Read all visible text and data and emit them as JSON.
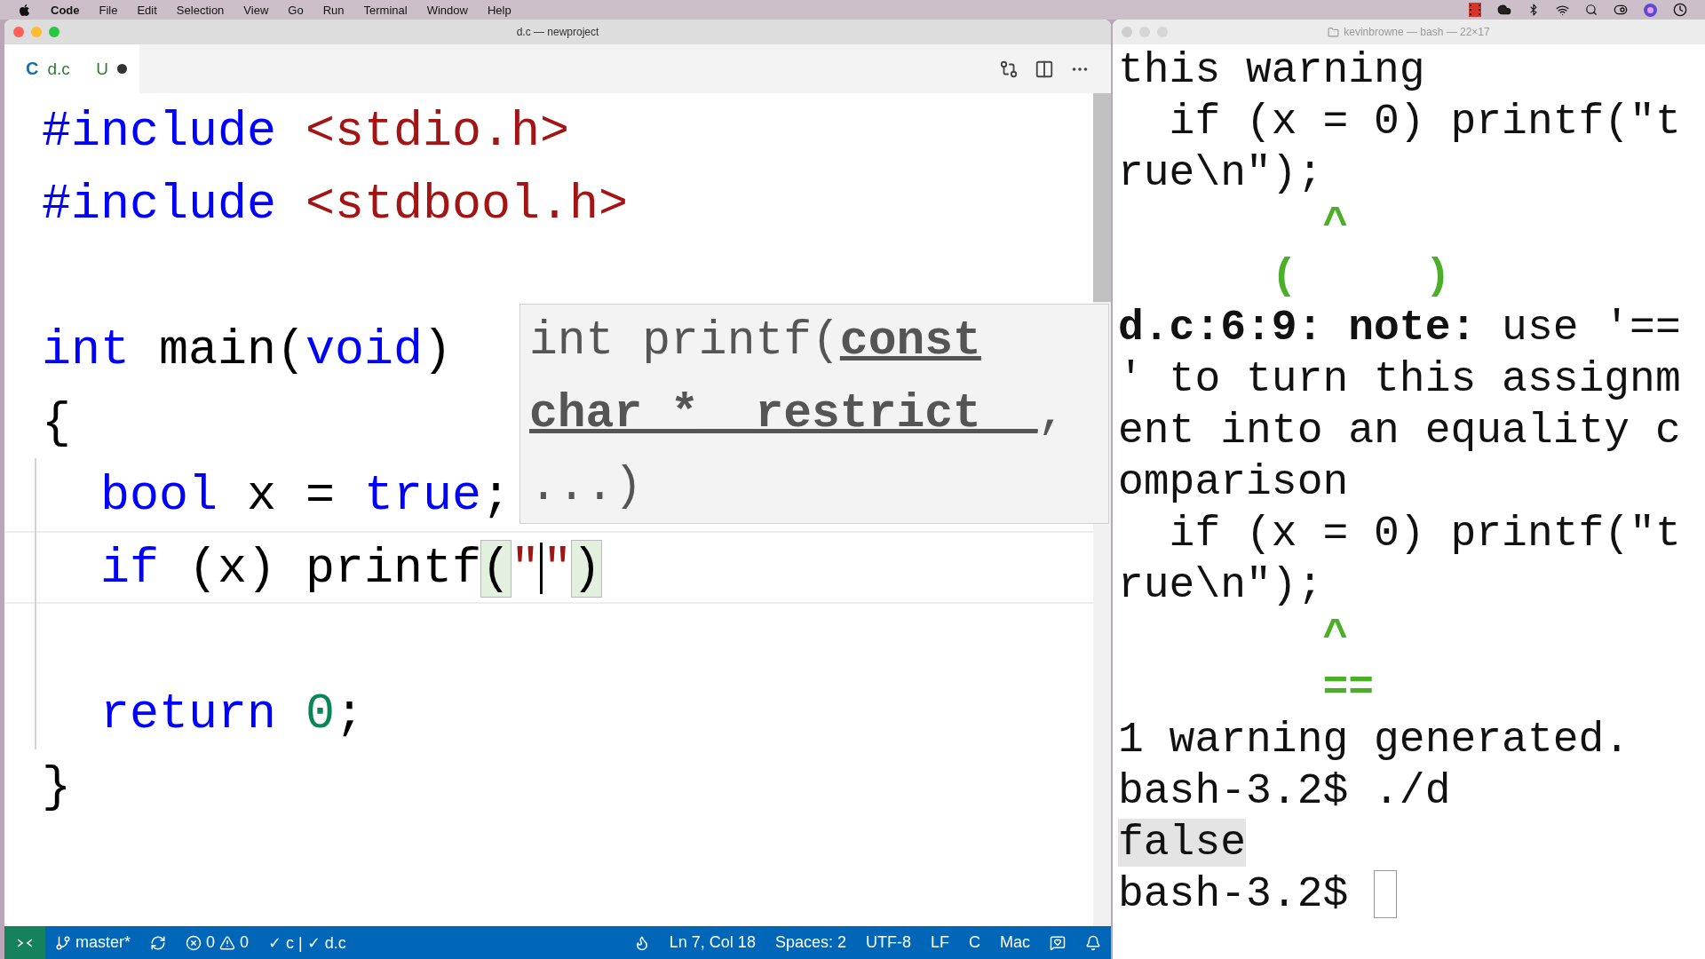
{
  "menu_bar": {
    "app": "Code",
    "items": [
      "File",
      "Edit",
      "Selection",
      "View",
      "Go",
      "Run",
      "Terminal",
      "Window",
      "Help"
    ]
  },
  "editor": {
    "window_title": "d.c — newproject",
    "tab": {
      "icon_letter": "C",
      "name": "d.c",
      "git_status": "U",
      "dirty": true,
      "selected": true
    },
    "code_lines": [
      {
        "current": false,
        "tokens": [
          {
            "kind": "keyword",
            "text": "#include"
          },
          {
            "kind": "string",
            "text": " <stdio.h>"
          }
        ]
      },
      {
        "current": false,
        "tokens": [
          {
            "kind": "keyword",
            "text": "#include"
          },
          {
            "kind": "string",
            "text": " <stdbool.h>"
          }
        ]
      },
      {
        "current": false
      },
      {
        "current": false,
        "tokens": [
          {
            "kind": "keyword",
            "text": "int"
          },
          {
            "kind": "plain",
            "text": " main("
          },
          {
            "kind": "keyword",
            "text": "void"
          },
          {
            "kind": "plain",
            "text": ")"
          }
        ]
      },
      {
        "current": false,
        "tokens": [
          {
            "kind": "plain",
            "text": "{"
          }
        ]
      },
      {
        "current": false,
        "tokens": [
          {
            "kind": "keyword",
            "text": "  bool"
          },
          {
            "kind": "plain",
            "text": " x = "
          },
          {
            "kind": "keyword",
            "text": "true"
          },
          {
            "kind": "plain",
            "text": ";"
          }
        ]
      },
      {
        "current": true,
        "tokens": [
          {
            "kind": "keyword",
            "text": "  if"
          },
          {
            "kind": "plain",
            "text": " (x) printf"
          },
          {
            "kind": "bracket",
            "text": "("
          },
          {
            "kind": "string",
            "text": "\""
          },
          {
            "kind": "caret"
          },
          {
            "kind": "string",
            "text": "\""
          },
          {
            "kind": "bracket",
            "text": ")"
          }
        ]
      },
      {
        "current": false
      },
      {
        "current": false,
        "tokens": [
          {
            "kind": "keyword",
            "text": "  return"
          },
          {
            "kind": "number",
            "text": " 0"
          },
          {
            "kind": "plain",
            "text": ";"
          }
        ]
      },
      {
        "current": false,
        "tokens": [
          {
            "kind": "plain",
            "text": "}"
          }
        ]
      }
    ],
    "hover": {
      "lines": [
        [
          {
            "kind": "plain",
            "text": "int printf("
          },
          {
            "kind": "param",
            "text": "const"
          }
        ],
        [
          {
            "kind": "param",
            "text": "char *__restrict__"
          },
          {
            "kind": "plain",
            "text": ","
          }
        ],
        [
          {
            "kind": "plain",
            "text": "...)"
          }
        ]
      ]
    },
    "status_bar": {
      "branch": "master*",
      "errors": "0",
      "warnings": "0",
      "checks": "✓ c | ✓ d.c",
      "position": "Ln 7, Col 18",
      "indent": "Spaces: 2",
      "encoding": "UTF-8",
      "eol": "LF",
      "language": "C",
      "platform": "Mac"
    }
  },
  "terminal": {
    "title": "kevinbrowne — bash — 22×17",
    "lines": [
      [
        {
          "kind": "plain",
          "text": "this warning"
        }
      ],
      [
        {
          "kind": "plain",
          "text": "  if (x = 0) printf(\"t"
        }
      ],
      [
        {
          "kind": "plain",
          "text": "rue\\n\");"
        }
      ],
      [
        {
          "kind": "green",
          "text": "        ^"
        }
      ],
      [
        {
          "kind": "green",
          "text": "      (     )"
        }
      ],
      [
        {
          "kind": "bold",
          "text": "d.c:6:9: note:"
        },
        {
          "kind": "plain",
          "text": " use '=="
        }
      ],
      [
        {
          "kind": "plain",
          "text": "' to turn this assignm"
        }
      ],
      [
        {
          "kind": "plain",
          "text": "ent into an equality c"
        }
      ],
      [
        {
          "kind": "plain",
          "text": "omparison"
        }
      ],
      [
        {
          "kind": "plain",
          "text": "  if (x = 0) printf(\"t"
        }
      ],
      [
        {
          "kind": "plain",
          "text": "rue\\n\");"
        }
      ],
      [
        {
          "kind": "green",
          "text": "        ^"
        }
      ],
      [
        {
          "kind": "green",
          "text": "        =="
        }
      ],
      [
        {
          "kind": "plain",
          "text": "1 warning generated."
        }
      ],
      [
        {
          "kind": "plain",
          "text": "bash-3.2$ ./d"
        }
      ],
      [
        {
          "kind": "selected",
          "text": "false"
        }
      ],
      [
        {
          "kind": "plain",
          "text": "bash-3.2$ "
        },
        {
          "kind": "cursor"
        }
      ]
    ]
  }
}
